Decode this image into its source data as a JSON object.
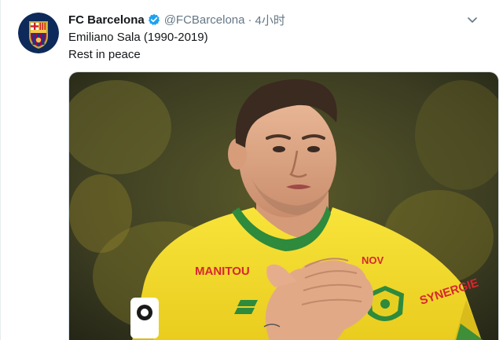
{
  "tweet": {
    "author": {
      "fullname": "FC Barcelona",
      "handle": "@FCBarcelona",
      "avatar_icon": "fc-barcelona-crest-icon",
      "verified_icon": "verified-badge-icon"
    },
    "separator": "·",
    "timestamp": "4小时",
    "lines": [
      "Emiliano Sala (1990-2019)",
      "Rest in peace"
    ],
    "menu_icon": "chevron-down-icon",
    "photo": {
      "jersey_texts": [
        "MANITOU",
        "SYNERGIE",
        "NOV"
      ],
      "colors": {
        "jersey": "#f6de2b",
        "collar": "#2e8a3c",
        "background": "#3a3a22"
      }
    }
  },
  "colors": {
    "verified": "#1da1f2",
    "muted": "#657786",
    "text": "#14171a"
  }
}
